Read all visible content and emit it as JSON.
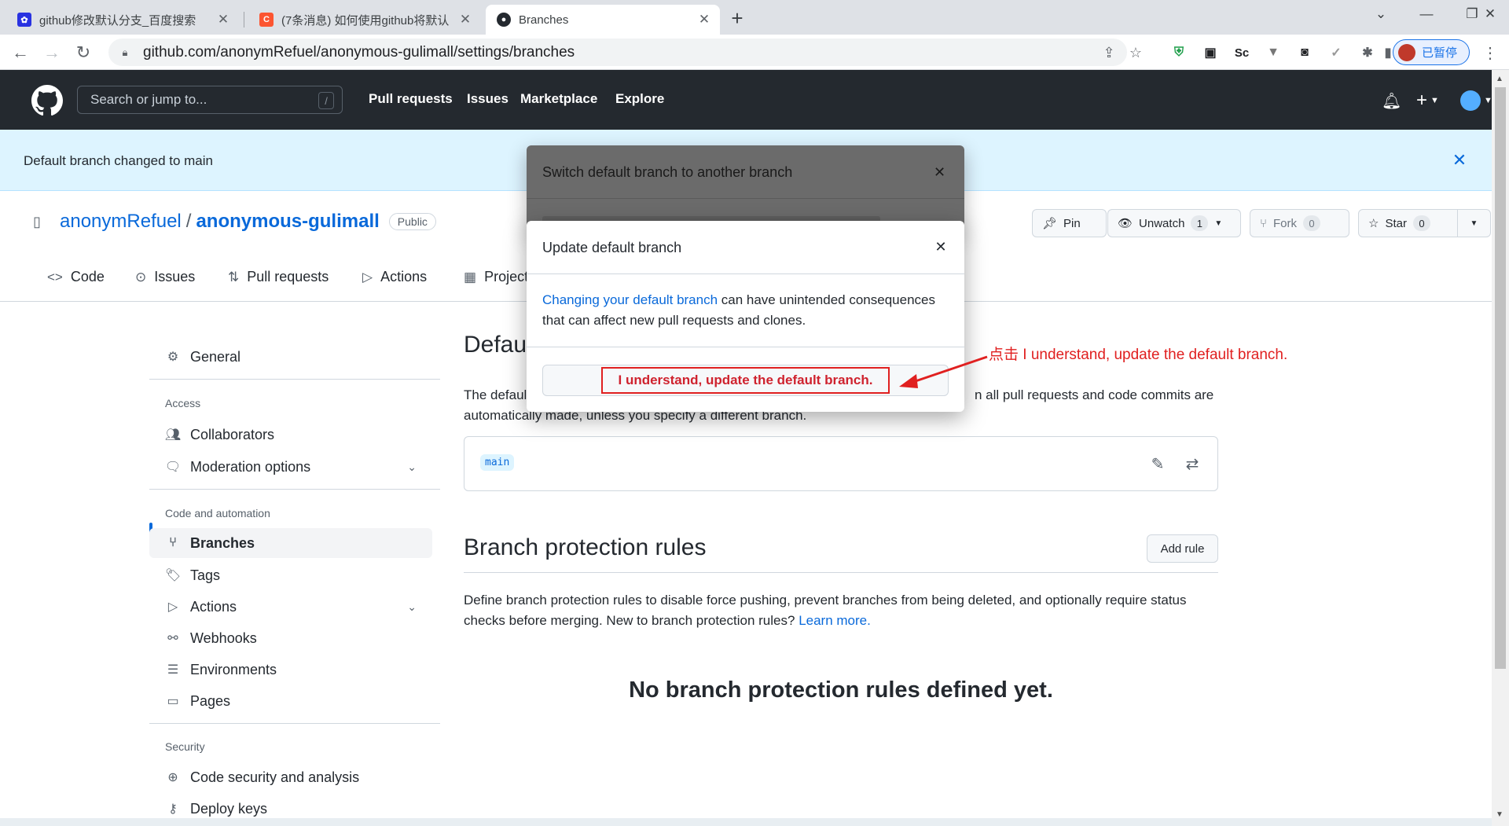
{
  "browser": {
    "tabs": [
      {
        "title": "github修改默认分支_百度搜索",
        "favicon": "baidu-paw"
      },
      {
        "title": "(7条消息) 如何使用github将默认",
        "favicon": "csdn-c"
      },
      {
        "title": "Branches",
        "favicon": "github-octocat"
      }
    ],
    "url": "github.com/anonymRefuel/anonymous-gulimall/settings/branches",
    "extensions": [
      "Sc"
    ],
    "profile_label": "已暂停"
  },
  "gh_header": {
    "search_placeholder": "Search or jump to...",
    "search_key": "/",
    "nav": [
      "Pull requests",
      "Issues",
      "Marketplace",
      "Explore"
    ]
  },
  "flash": {
    "message": "Default branch changed to main"
  },
  "repo": {
    "owner": "anonymRefuel",
    "separator": "/",
    "name": "anonymous-gulimall",
    "visibility": "Public",
    "pin_label": "Pin",
    "unwatch_label": "Unwatch",
    "watch_count": "1",
    "fork_label": "Fork",
    "fork_count": "0",
    "star_label": "Star",
    "star_count": "0",
    "tabs": [
      "Code",
      "Issues",
      "Pull requests",
      "Actions",
      "Projects"
    ]
  },
  "sidebar": {
    "general": "General",
    "access_heading": "Access",
    "access_items": [
      "Collaborators",
      "Moderation options"
    ],
    "code_heading": "Code and automation",
    "code_items": [
      "Branches",
      "Tags",
      "Actions",
      "Webhooks",
      "Environments",
      "Pages"
    ],
    "security_heading": "Security",
    "security_items": [
      "Code security and analysis",
      "Deploy keys"
    ]
  },
  "main": {
    "default_title": "Defau",
    "default_desc_left": "The defaul",
    "default_desc_right": "n all pull requests and code commits are",
    "default_desc_line2": "automatically made, unless you specify a different branch.",
    "default_branch": "main",
    "protection_title": "Branch protection rules",
    "add_rule": "Add rule",
    "protection_desc": "Define branch protection rules to disable force pushing, prevent branches from being deleted, and optionally require status checks before merging. New to branch protection rules?",
    "learn_more": "Learn more.",
    "empty_state": "No branch protection rules defined yet."
  },
  "modal_back": {
    "title": "Switch default branch to another branch"
  },
  "modal": {
    "title": "Update default branch",
    "link_text": "Changing your default branch",
    "body_text": " can have unintended consequences that can affect new pull requests and clones.",
    "confirm_label": "I understand, update the default branch."
  },
  "annotation": "点击 I understand, update the default branch.",
  "colors": {
    "accent": "#0969da",
    "header": "#24292f",
    "flash_bg": "#ddf4ff",
    "annotation": "#e02020"
  }
}
